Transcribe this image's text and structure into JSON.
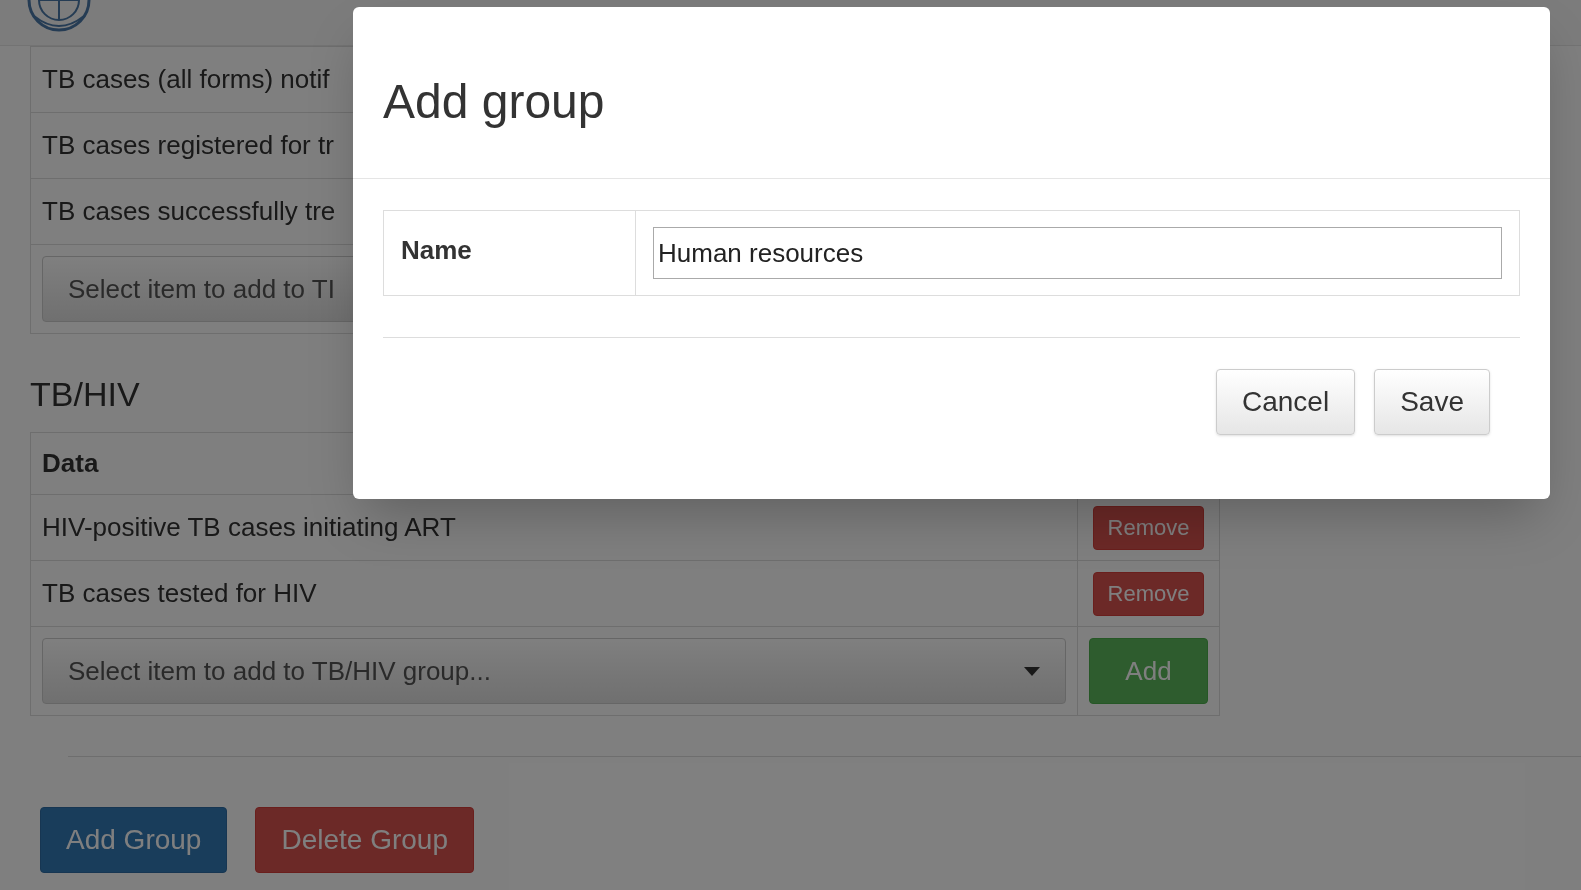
{
  "groups": [
    {
      "rows": [
        "TB cases (all forms) notif",
        "TB cases registered for tr",
        "TB cases successfully tre"
      ],
      "select_placeholder": "Select item to add to TI"
    },
    {
      "title": "TB/HIV",
      "header": "Data",
      "rows": [
        {
          "label": "HIV-positive TB cases initiating ART",
          "action": "Remove"
        },
        {
          "label": "TB cases tested for HIV",
          "action": "Remove"
        }
      ],
      "select_placeholder": "Select item to add to TB/HIV group...",
      "add_button": "Add"
    }
  ],
  "buttons": [
    {
      "label": "Add Group",
      "kind": "primary"
    },
    {
      "label": "Delete Group",
      "kind": "danger"
    }
  ],
  "dialog": {
    "title": "Add group",
    "field_label": "Name",
    "field_value": "Human resources",
    "buttons": [
      {
        "label": "Cancel"
      },
      {
        "label": "Save"
      }
    ]
  }
}
